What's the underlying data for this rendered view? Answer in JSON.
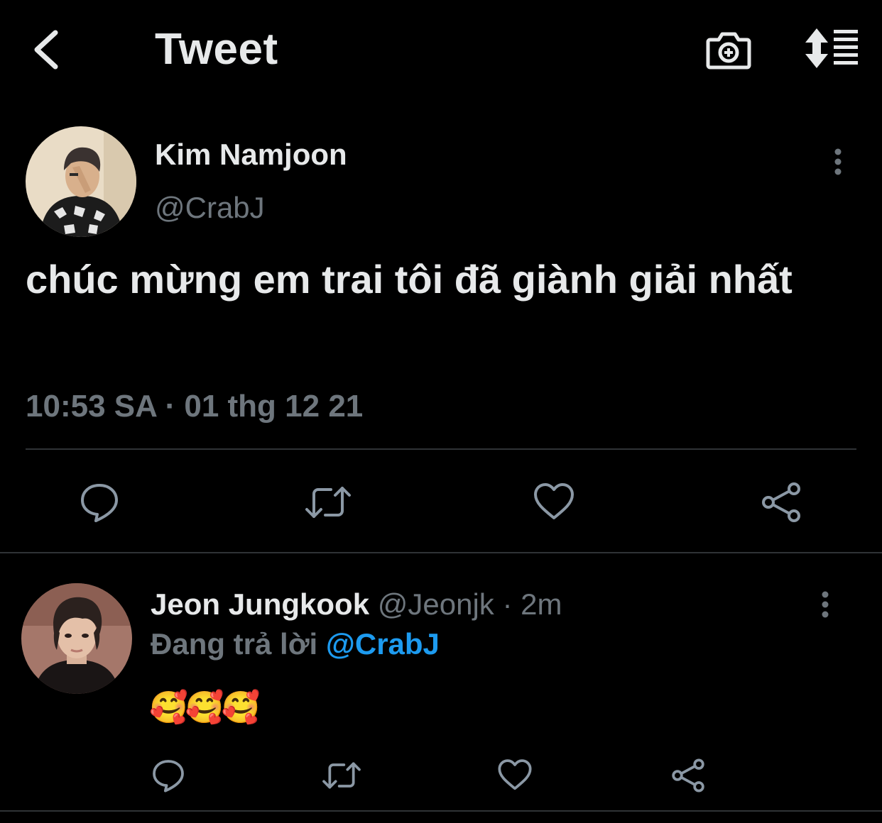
{
  "header": {
    "title": "Tweet",
    "back_icon": "chevron-left-icon",
    "camera_icon": "camera-plus-icon",
    "sort_icon": "sort-list-icon"
  },
  "main_tweet": {
    "display_name": "Kim Namjoon",
    "handle": "@CrabJ",
    "text": "chúc mừng em trai tôi đã giành giải nhất",
    "timestamp": "10:53 SA · 01 thg 12 21",
    "actions": [
      "reply-icon",
      "retweet-icon",
      "like-icon",
      "share-icon"
    ]
  },
  "reply": {
    "display_name": "Jeon Jungkook",
    "handle": "@Jeonjk",
    "separator": " · ",
    "time_ago": "2m",
    "replying_to_label": "Đang trả lời ",
    "replying_to_handle": "@CrabJ",
    "text": "🥰🥰🥰",
    "actions": [
      "reply-icon",
      "retweet-icon",
      "like-icon",
      "share-icon"
    ]
  },
  "colors": {
    "background": "#000000",
    "primary_text": "#e7e9ea",
    "secondary_text": "#6e767d",
    "accent": "#1d9bf0",
    "divider": "#2f3336"
  }
}
